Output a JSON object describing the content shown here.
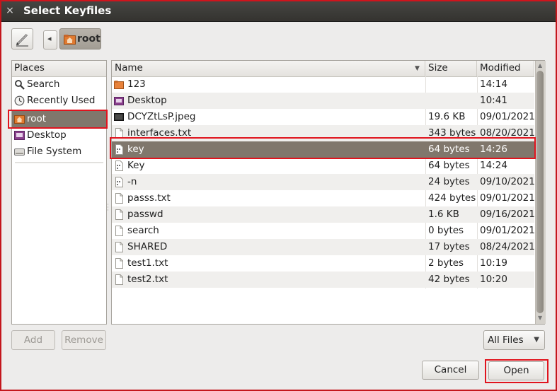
{
  "window": {
    "title": "Select Keyfiles",
    "close_glyph": "×"
  },
  "toolbar": {
    "path_label": "root",
    "back_glyph": "◂"
  },
  "places": {
    "header": "Places",
    "items": [
      {
        "label": "Search",
        "icon": "search-icon"
      },
      {
        "label": "Recently Used",
        "icon": "clock-icon"
      },
      {
        "label": "root",
        "icon": "home-folder-icon",
        "selected": true
      },
      {
        "label": "Desktop",
        "icon": "desktop-folder-icon"
      },
      {
        "label": "File System",
        "icon": "drive-icon"
      }
    ]
  },
  "files": {
    "columns": {
      "name": "Name",
      "size": "Size",
      "modified": "Modified"
    },
    "sort_glyph": "▼",
    "rows": [
      {
        "name": "123",
        "size": "",
        "modified": "14:14",
        "icon": "folder-icon"
      },
      {
        "name": "Desktop",
        "size": "",
        "modified": "10:41",
        "icon": "desktop-folder-icon"
      },
      {
        "name": "DCYZtLsP.jpeg",
        "size": "19.6 KB",
        "modified": "09/01/2021",
        "icon": "image-file-icon"
      },
      {
        "name": "interfaces.txt",
        "size": "343 bytes",
        "modified": "08/20/2021",
        "icon": "file-icon"
      },
      {
        "name": "key",
        "size": "64 bytes",
        "modified": "14:26",
        "icon": "binary-file-icon",
        "selected": true
      },
      {
        "name": "Key",
        "size": "64 bytes",
        "modified": "14:24",
        "icon": "binary-file-icon"
      },
      {
        "name": "-n",
        "size": "24 bytes",
        "modified": "09/10/2021",
        "icon": "binary-file-icon"
      },
      {
        "name": "passs.txt",
        "size": "424 bytes",
        "modified": "09/01/2021",
        "icon": "file-icon"
      },
      {
        "name": "passwd",
        "size": "1.6 KB",
        "modified": "09/16/2021",
        "icon": "file-icon"
      },
      {
        "name": "search",
        "size": "0 bytes",
        "modified": "09/01/2021",
        "icon": "file-icon"
      },
      {
        "name": "SHARED",
        "size": "17 bytes",
        "modified": "08/24/2021",
        "icon": "file-icon"
      },
      {
        "name": "test1.txt",
        "size": "2 bytes",
        "modified": "10:19",
        "icon": "file-icon"
      },
      {
        "name": "test2.txt",
        "size": "42 bytes",
        "modified": "10:20",
        "icon": "file-icon"
      }
    ]
  },
  "buttons": {
    "add": "Add",
    "remove": "Remove",
    "cancel": "Cancel",
    "open": "Open"
  },
  "filter": {
    "selected": "All Files",
    "caret": "▼"
  },
  "colors": {
    "selection": "#80776c",
    "highlight_box": "#e0141e",
    "titlebar": "#3c3b37",
    "folder_orange": "#e0782e"
  }
}
